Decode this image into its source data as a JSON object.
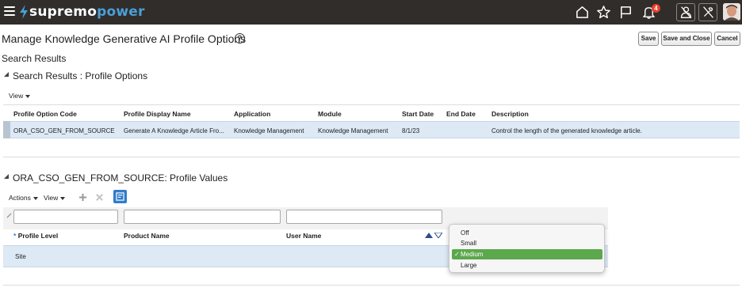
{
  "brand": {
    "part1": "supremo",
    "part2": "power",
    "accent": "#4a9fd8"
  },
  "header_icons": [
    "home-icon",
    "star-icon",
    "flag-icon",
    "bell-icon",
    "user-block-icon",
    "tools-icon"
  ],
  "notification_count": "4",
  "page": {
    "title": "Manage Knowledge Generative AI Profile Options",
    "help": "?",
    "subtitle": "Search Results"
  },
  "buttons": {
    "save": "Save",
    "save_close": "Save and Close",
    "cancel": "Cancel"
  },
  "section1": {
    "title": "Search Results : Profile Options",
    "view_label": "View",
    "columns": [
      "Profile Option Code",
      "Profile Display Name",
      "Application",
      "Module",
      "Start Date",
      "End Date",
      "Description"
    ],
    "row": {
      "code": "ORA_CSO_GEN_FROM_SOURCE",
      "display_name": "Generate A Knowledge Article Fro...",
      "application": "Knowledge Management",
      "module": "Knowledge Management",
      "start_date": "8/1/23",
      "end_date": "",
      "description": "Control the length of the generated knowledge article."
    }
  },
  "section2": {
    "title": "ORA_CSO_GEN_FROM_SOURCE: Profile Values",
    "actions_label": "Actions",
    "view_label": "View",
    "required_mark": "*",
    "columns": [
      "Profile Level",
      "Product Name",
      "User Name"
    ],
    "row": {
      "profile_level": "Site",
      "product_name": "",
      "user_name": ""
    }
  },
  "dropdown": {
    "options": [
      "Off",
      "Small",
      "Medium",
      "Large"
    ],
    "selected": "Medium",
    "check": "✓",
    "highlight": "#5ca84d"
  }
}
